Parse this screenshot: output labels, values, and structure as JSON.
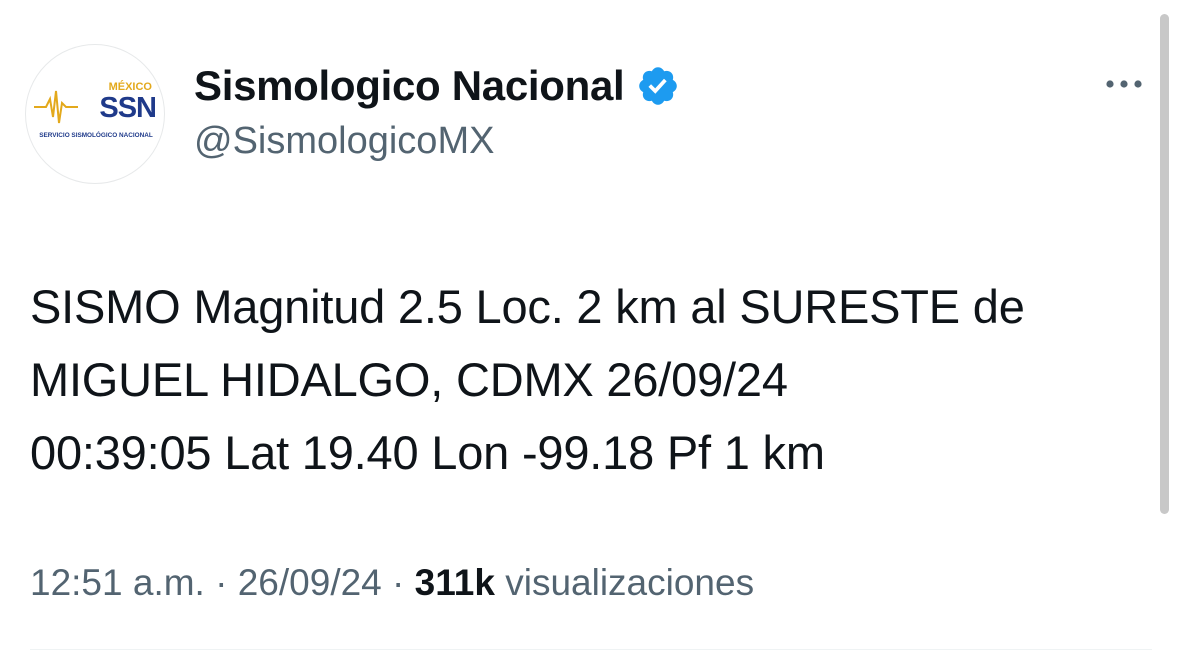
{
  "author": {
    "display_name": "Sismologico Nacional",
    "handle": "@SismologicoMX",
    "verified": true,
    "avatar": {
      "top_text": "MÉXICO",
      "logo_text": "SSN",
      "bottom_text": "SERVICIO SISMOLÓGICO NACIONAL"
    }
  },
  "tweet": {
    "lines": [
      "SISMO Magnitud 2.5 Loc. 2 km al SURESTE de",
      "MIGUEL HIDALGO, CDMX 26/09/24",
      "00:39:05 Lat 19.40 Lon -99.18 Pf 1 km"
    ]
  },
  "meta": {
    "time": "12:51 a.m.",
    "separator": "·",
    "date": "26/09/24",
    "views_count": "311k",
    "views_label": "visualizaciones"
  },
  "icons": {
    "verified": "verified-badge-icon",
    "more": "more-horizontal-icon"
  },
  "colors": {
    "verified_blue": "#1d9bf0",
    "text_primary": "#0f1419",
    "text_secondary": "#536471",
    "logo_blue": "#1f3a8a",
    "logo_gold": "#e3a91c"
  }
}
